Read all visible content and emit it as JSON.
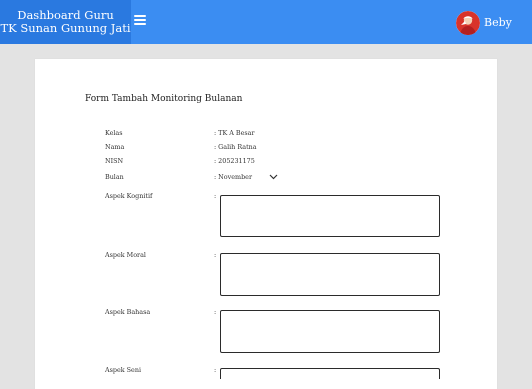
{
  "header": {
    "brand_line1": "Dashboard Guru",
    "brand_line2": "TK Sunan Gunung Jati",
    "username": "Beby",
    "bar_color": "#3b8df2",
    "brand_color": "#2a79e0"
  },
  "form": {
    "title": "Form Tambah Monitoring Bulanan",
    "fields": {
      "kelas": {
        "label": "Kelas",
        "value": ": TK A Besar"
      },
      "nama": {
        "label": "Nama",
        "value": ": Galih Ratna"
      },
      "nisn": {
        "label": "NISN",
        "value": ": 205231175"
      },
      "bulan": {
        "label": "Bulan",
        "value": ": November"
      }
    },
    "aspects": {
      "kognitif": {
        "label": "Aspek Kognitif",
        "colon": ":"
      },
      "moral": {
        "label": "Aspek Moral",
        "colon": ":"
      },
      "bahasa": {
        "label": "Aspek Bahasa",
        "colon": ":"
      },
      "seni": {
        "label": "Aspek Seni",
        "colon": ":"
      }
    }
  }
}
